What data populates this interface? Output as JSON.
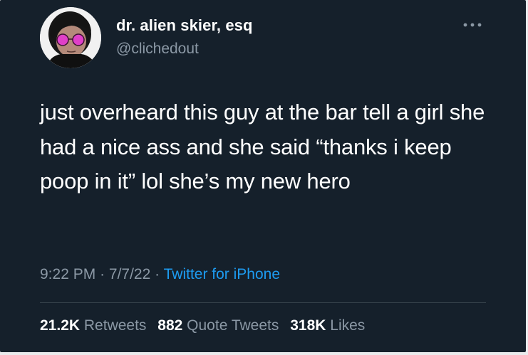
{
  "author": {
    "display_name": "dr. alien skier, esq",
    "handle": "@clichedout"
  },
  "tweet": {
    "text": "just overheard this guy at the bar tell a girl she had a nice ass and she said “thanks i keep poop in it” lol she’s my new hero",
    "time": "9:22 PM",
    "separator": "·",
    "date": "7/7/22",
    "source": "Twitter for iPhone"
  },
  "stats": {
    "retweets_count": "21.2K",
    "retweets_label": "Retweets",
    "quotes_count": "882",
    "quotes_label": "Quote Tweets",
    "likes_count": "318K",
    "likes_label": "Likes"
  },
  "icons": {
    "more": "more-horizontal-icon",
    "avatar": "profile-photo"
  },
  "colors": {
    "background": "#15202b",
    "primary_text": "#ffffff",
    "secondary_text": "#8b98a5",
    "link": "#1d9bf0",
    "divider": "#38444d"
  }
}
